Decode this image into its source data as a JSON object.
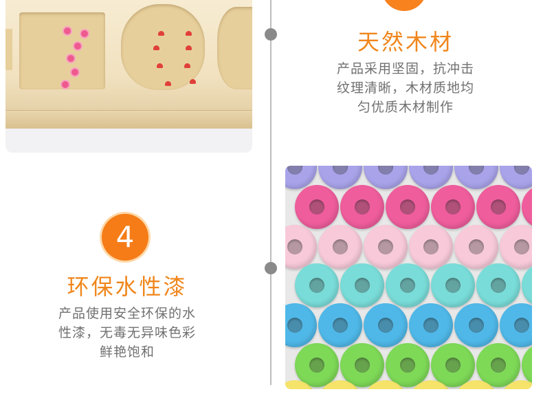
{
  "feature_wood": {
    "title": "天然木材",
    "lines": [
      "产品采用坚固，抗冲击",
      "纹理清晰，木材质地均",
      "匀优质木材制作"
    ]
  },
  "feature_paint": {
    "number": "4",
    "title": "环保水性漆",
    "lines": [
      "产品使用安全环保的水",
      "性漆，无毒无异味色彩",
      "鲜艳饱和"
    ]
  },
  "colors": {
    "accent": "#f0861c",
    "text_gray": "#707070",
    "ring_rows": [
      "#a9a3ea",
      "#ef5d9c",
      "#f7c9d9",
      "#79dcd8",
      "#4fb8e8",
      "#7ed957",
      "#f5e36a"
    ]
  }
}
